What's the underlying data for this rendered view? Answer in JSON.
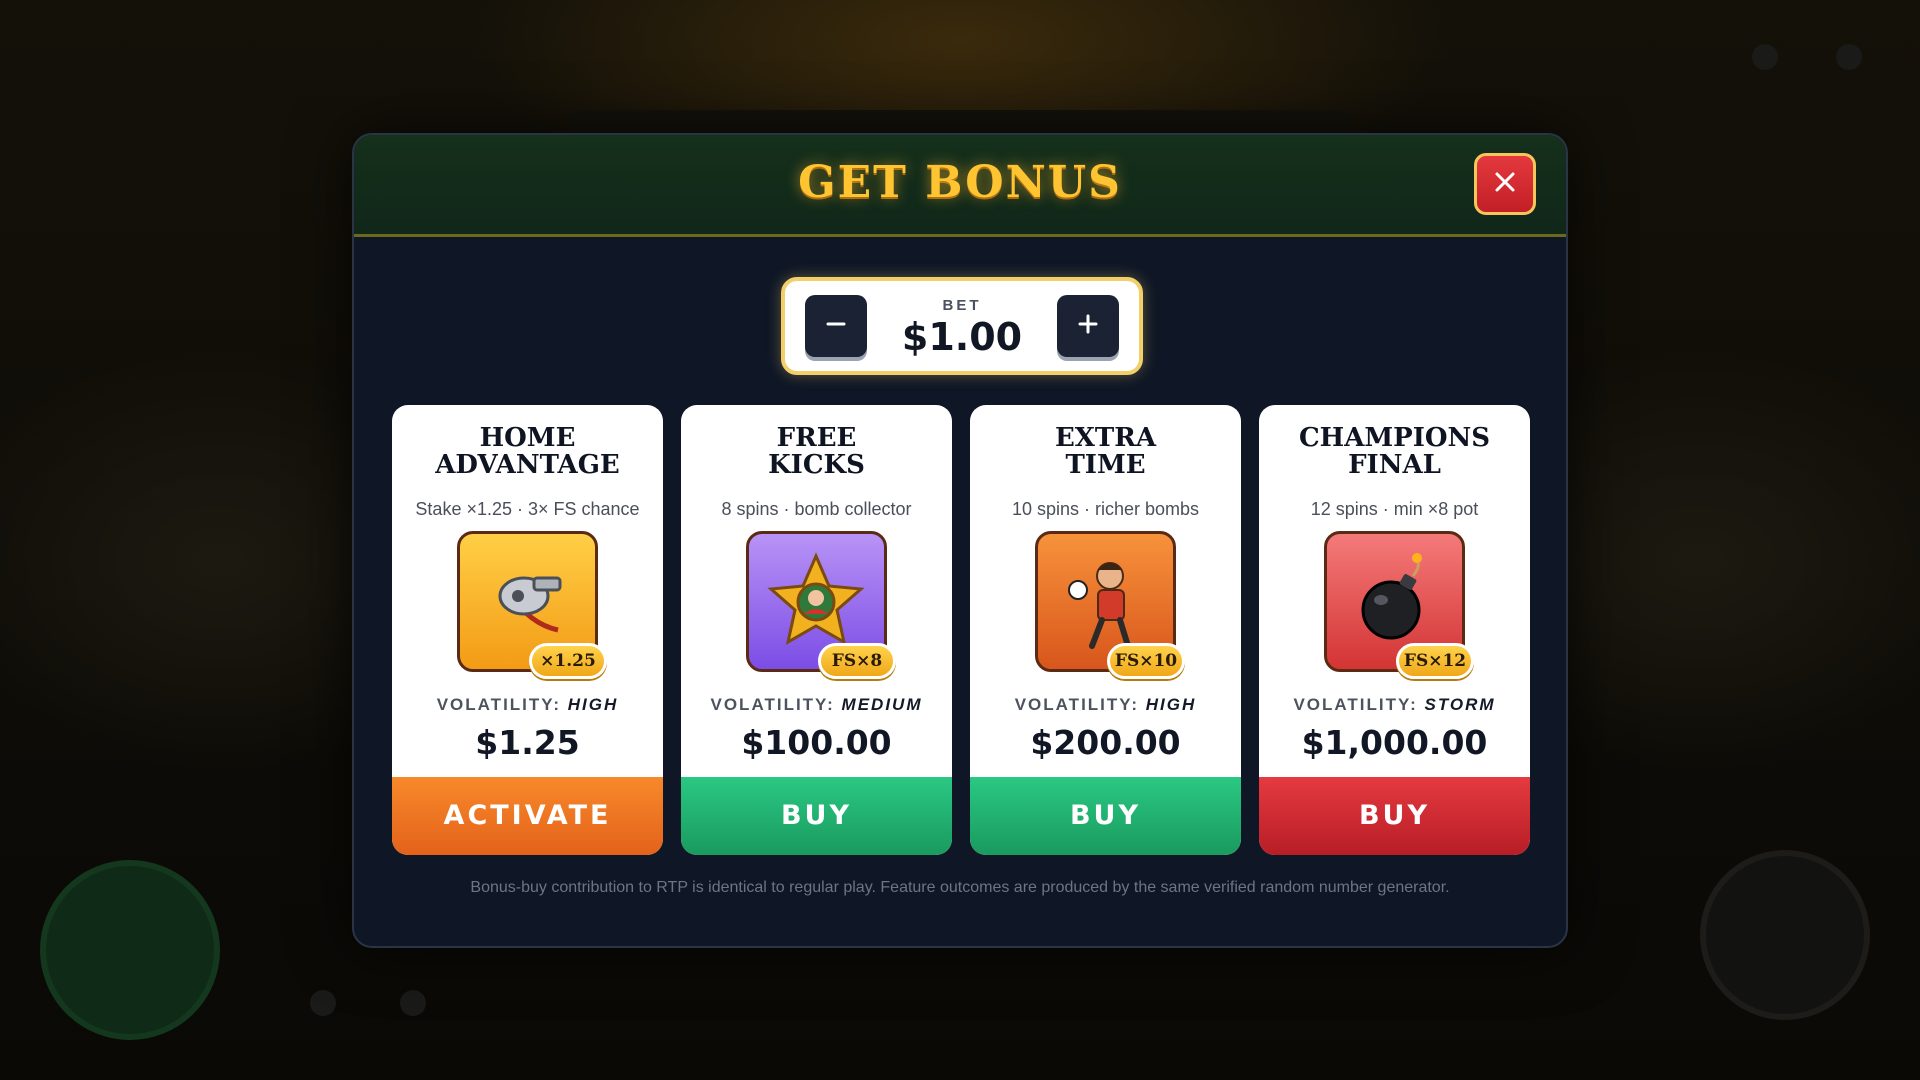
{
  "modal": {
    "title": "GET BONUS",
    "close_icon": "close-icon"
  },
  "bet": {
    "label": "BET",
    "value": "$1.00",
    "minus_icon": "minus-icon",
    "plus_icon": "plus-icon"
  },
  "cards": [
    {
      "title_line1": "HOME",
      "title_line2": "ADVANTAGE",
      "subtitle": "Stake ×1.25 · 3× FS chance",
      "icon": "whistle-icon",
      "badge": "×1.25",
      "volatility_label": "VOLATILITY:",
      "volatility": "HIGH",
      "price": "$1.25",
      "button": "ACTIVATE",
      "accent": "#f8892b"
    },
    {
      "title_line1": "FREE",
      "title_line2": "KICKS",
      "subtitle": "8 spins · bomb collector",
      "icon": "star-badge-icon",
      "badge": "FS×8",
      "volatility_label": "VOLATILITY:",
      "volatility": "MEDIUM",
      "price": "$100.00",
      "button": "BUY",
      "accent": "#2ac883"
    },
    {
      "title_line1": "EXTRA",
      "title_line2": "TIME",
      "subtitle": "10 spins · richer bombs",
      "icon": "footballer-icon",
      "badge": "FS×10",
      "volatility_label": "VOLATILITY:",
      "volatility": "HIGH",
      "price": "$200.00",
      "button": "BUY",
      "accent": "#2ac883"
    },
    {
      "title_line1": "CHAMPIONS",
      "title_line2": "FINAL",
      "subtitle": "12 spins · min ×8 pot",
      "icon": "bomb-icon",
      "badge": "FS×12",
      "volatility_label": "VOLATILITY:",
      "volatility": "STORM",
      "price": "$1,000.00",
      "button": "BUY",
      "accent": "#e53a40"
    }
  ],
  "footnote": "Bonus-buy contribution to RTP is identical to regular play. Feature outcomes are produced by the same verified random number generator.",
  "colors": {
    "title_gold": "#ffc431",
    "modal_bg": "#0f1726",
    "header_green": "#15301b"
  }
}
